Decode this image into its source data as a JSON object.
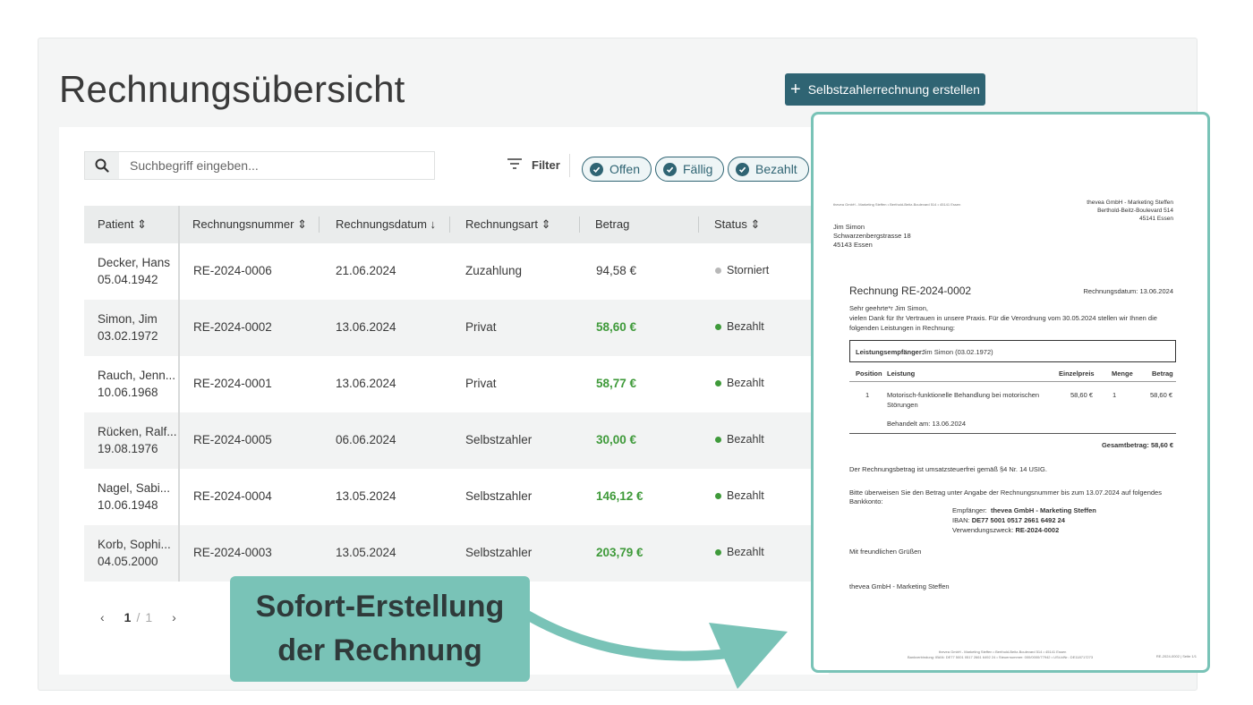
{
  "page": {
    "title": "Rechnungsübersicht"
  },
  "toolbar": {
    "create_label": "Selbstzahlerrechnung erstellen"
  },
  "search": {
    "placeholder": "Suchbegriff eingeben..."
  },
  "filter": {
    "label": "Filter",
    "chips": [
      {
        "label": "Offen"
      },
      {
        "label": "Fällig"
      },
      {
        "label": "Bezahlt"
      }
    ]
  },
  "table": {
    "columns": [
      "Patient",
      "Rechnungsnummer",
      "Rechnungsdatum",
      "Rechnungsart",
      "Betrag",
      "Status"
    ],
    "rows": [
      {
        "name": "Decker, Hans",
        "dob": "05.04.1942",
        "number": "RE-2024-0006",
        "date": "21.06.2024",
        "type": "Zuzahlung",
        "amount": "94,58 €",
        "status": "Storniert"
      },
      {
        "name": "Simon, Jim",
        "dob": "03.02.1972",
        "number": "RE-2024-0002",
        "date": "13.06.2024",
        "type": "Privat",
        "amount": "58,60 €",
        "status": "Bezahlt"
      },
      {
        "name": "Rauch, Jenn...",
        "dob": "10.06.1968",
        "number": "RE-2024-0001",
        "date": "13.06.2024",
        "type": "Privat",
        "amount": "58,77 €",
        "status": "Bezahlt"
      },
      {
        "name": "Rücken, Ralf...",
        "dob": "19.08.1976",
        "number": "RE-2024-0005",
        "date": "06.06.2024",
        "type": "Selbstzahler",
        "amount": "30,00 €",
        "status": "Bezahlt"
      },
      {
        "name": "Nagel, Sabi...",
        "dob": "10.06.1948",
        "number": "RE-2024-0004",
        "date": "13.05.2024",
        "type": "Selbstzahler",
        "amount": "146,12 €",
        "status": "Bezahlt"
      },
      {
        "name": "Korb, Sophi...",
        "dob": "04.05.2000",
        "number": "RE-2024-0003",
        "date": "13.05.2024",
        "type": "Selbstzahler",
        "amount": "203,79 €",
        "status": "Bezahlt"
      }
    ]
  },
  "pagination": {
    "current": "1",
    "separator": "/",
    "total": "1"
  },
  "invoice": {
    "sender_line": "thevea GmbH - Marketing Steffen • Berthold-Beitz-Boulevard 514 • 45141 Essen",
    "company": "thevea GmbH - Marketing Steffen",
    "company_street": "Berthold-Beitz-Boulevard 514",
    "company_city": "45141 Essen",
    "recipient_name": "Jim Simon",
    "recipient_street": "Schwarzenbergstrasse 18",
    "recipient_city": "45143 Essen",
    "title": "Rechnung RE-2024-0002",
    "date": "Rechnungsdatum: 13.06.2024",
    "salutation": "Sehr geehrte*r Jim Simon,",
    "intro_1": "vielen Dank für Ihr Vertrauen in unsere Praxis. Für die Verordnung vom 30.05.2024 stellen wir Ihnen die",
    "intro_2": "folgenden Leistungen in Rechnung:",
    "recipient_box_label": "Leistungsempfänger:",
    "recipient_box_value": "Jim Simon (03.02.1972)",
    "col_position": "Position",
    "col_service": "Leistung",
    "col_unit": "Einzelpreis",
    "col_qty": "Menge",
    "col_amount": "Betrag",
    "item_pos": "1",
    "item_service_1": "Motorisch-funktionelle Behandlung bei motorischen",
    "item_service_2": "Störungen",
    "item_unit": "58,60 €",
    "item_qty": "1",
    "item_amount": "58,60 €",
    "treated": "Behandelt am: 13.06.2024",
    "total": "Gesamtbetrag: 58,60 €",
    "tax_note": "Der Rechnungsbetrag ist umsatzsteuerfrei gemäß §4 Nr. 14 USIG.",
    "pay_1": "Bitte überweisen Sie den Betrag unter Angabe der Rechnungsnummer bis zum 13.07.2024 auf folgendes",
    "pay_2": "Bankkonto:",
    "receiver_label": "Empfänger:",
    "receiver_value": "thevea GmbH - Marketing Steffen",
    "iban_label": "IBAN:",
    "iban_value": "DE77 5001 0517 2661 6492 24",
    "purpose_label": "Verwendungszweck:",
    "purpose_value": "RE-2024-0002",
    "greeting": "Mit freundlichen Grüßen",
    "signature": "thevea GmbH - Marketing Steffen",
    "footer_1": "thevea GmbH - Marketing Steffen • Berthold-Beitz-Boulevard 514 • 45141 Essen",
    "footer_2": "Bankverbindung: IBAN: DE77 5001 0517 2661 6492 24 • Steuernummer: 000/0000/77942 • USt-IdNr.: DE118717273",
    "page_label": "RE-2024-0002 | Seite 1/1"
  },
  "callout": {
    "line1": "Sofort-Erstellung",
    "line2": "der Rechnung"
  },
  "colors": {
    "primary": "#2f6473",
    "accent": "#79c3b7",
    "paid": "#3f9a3a",
    "cancelled": "#b8b8b8"
  }
}
